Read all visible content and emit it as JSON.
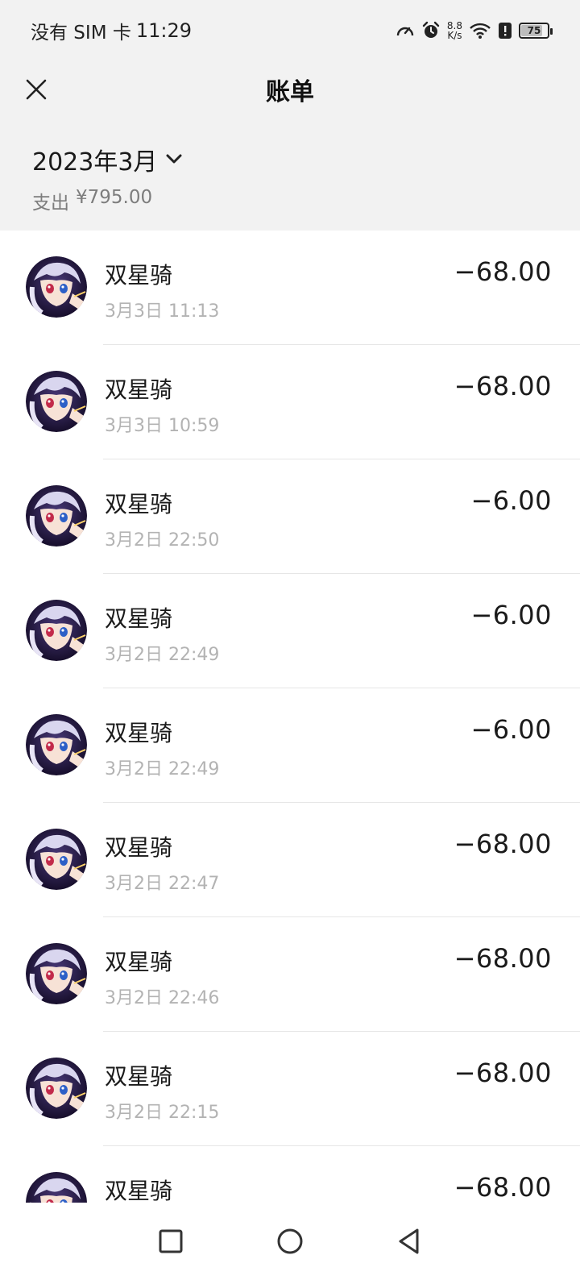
{
  "status_bar": {
    "carrier": "没有 SIM 卡",
    "time": "11:29",
    "net_speed_value": "8.8",
    "net_speed_unit": "K/s",
    "battery_level": "75",
    "icons": [
      "speedometer-icon",
      "alarm-icon",
      "wifi-icon",
      "alert-icon",
      "battery-icon"
    ]
  },
  "nav": {
    "title": "账单",
    "close_icon": "close-icon"
  },
  "month_header": {
    "month": "2023年3月",
    "summary_label": "支出",
    "summary_amount": "¥795.00"
  },
  "transactions": [
    {
      "name": "双星骑",
      "time": "3月3日 11:13",
      "amount": "−68.00"
    },
    {
      "name": "双星骑",
      "time": "3月3日 10:59",
      "amount": "−68.00"
    },
    {
      "name": "双星骑",
      "time": "3月2日 22:50",
      "amount": "−6.00"
    },
    {
      "name": "双星骑",
      "time": "3月2日 22:49",
      "amount": "−6.00"
    },
    {
      "name": "双星骑",
      "time": "3月2日 22:49",
      "amount": "−6.00"
    },
    {
      "name": "双星骑",
      "time": "3月2日 22:47",
      "amount": "−68.00"
    },
    {
      "name": "双星骑",
      "time": "3月2日 22:46",
      "amount": "−68.00"
    },
    {
      "name": "双星骑",
      "time": "3月2日 22:15",
      "amount": "−68.00"
    },
    {
      "name": "双星骑",
      "time": "",
      "amount": "−68.00"
    }
  ],
  "system_nav": {
    "icons": [
      "recents-square-icon",
      "home-circle-icon",
      "back-triangle-icon"
    ]
  },
  "colors": {
    "header_bg": "#f2f2f2",
    "list_bg": "#ffffff",
    "secondary_text": "#7d7d7d",
    "time_text": "#b3b3b3",
    "divider": "#e6e6e6"
  }
}
